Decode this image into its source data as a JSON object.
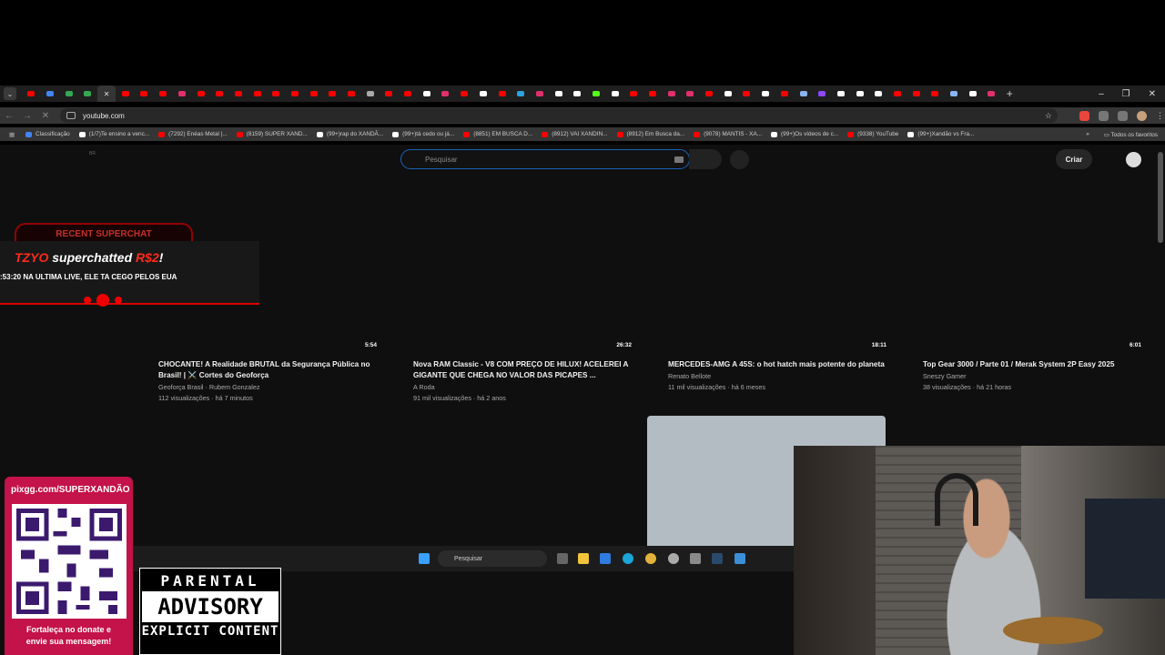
{
  "browser": {
    "url": "youtube.com",
    "tab_colors": [
      "#ff0000",
      "#4285f4",
      "#34a853",
      "#34a853",
      "#ff0000",
      "#ff0000",
      "#ff0000",
      "#ff0000",
      "#e1306c",
      "#ff0000",
      "#ff0000",
      "#ff0000",
      "#ff0000",
      "#ff0000",
      "#ff0000",
      "#ff0000",
      "#ff0000",
      "#ff0000",
      "#aaaaaa",
      "#ff0000",
      "#ff0000",
      "#ffffff",
      "#e1306c",
      "#ff0000",
      "#ffffff",
      "#ff0000",
      "#2aa3e0",
      "#e1306c",
      "#ffffff",
      "#ffffff",
      "#53fc18",
      "#ffffff",
      "#ff0000",
      "#ff0000",
      "#e1306c",
      "#e1306c",
      "#ff0000",
      "#ffffff",
      "#ff0000",
      "#ffffff",
      "#ff0000",
      "#8ab4f8",
      "#9146ff",
      "#ffffff",
      "#ffffff",
      "#ffffff",
      "#ff0000",
      "#ff0000",
      "#ff0000",
      "#8ab4f8",
      "#ffffff",
      "#e1306c"
    ],
    "new_tab": "+",
    "window_controls": [
      "–",
      "❐",
      "✕"
    ],
    "bookmarks": [
      {
        "label": "Classificação",
        "color": "#4285f4"
      },
      {
        "label": "(1/7)Te ensino a venc...",
        "color": "#ffffff"
      },
      {
        "label": "(7292) Enéas Metal |...",
        "color": "#ff0000"
      },
      {
        "label": "(8159) SUPER XAND...",
        "color": "#ff0000"
      },
      {
        "label": "(99+)rap do XANDÃ...",
        "color": "#ffffff"
      },
      {
        "label": "(99+)tá cedo ou já...",
        "color": "#ffffff"
      },
      {
        "label": "(8851) EM BUSCA D...",
        "color": "#ff0000"
      },
      {
        "label": "(8912) VAI XANDIN...",
        "color": "#ff0000"
      },
      {
        "label": "(8912) Em Busca da...",
        "color": "#ff0000"
      },
      {
        "label": "(9078) MANTIS - XA...",
        "color": "#ff0000"
      },
      {
        "label": "(99+)Os vídeos de c...",
        "color": "#ffffff"
      },
      {
        "label": "(9338) YouTube",
        "color": "#ff0000"
      },
      {
        "label": "(99+)Xandão vs Fra...",
        "color": "#ffffff"
      }
    ],
    "bookmarks_more": "»",
    "all_bookmarks": "Todos os favoritos"
  },
  "youtube": {
    "logo_region": "BR",
    "search_placeholder": "Pesquisar",
    "create_label": "Criar",
    "videos": [
      {
        "duration": "5:54",
        "title": "CHOCANTE! A Realidade BRUTAL da Segurança Pública no Brasil! | ⚔️ Cortes do Geoforça",
        "channel": "Geoforça Brasil · Rubem Gonzalez",
        "stats": "112 visualizações · há 7 minutos"
      },
      {
        "duration": "26:32",
        "title": "Nova RAM Classic - V8 COM PREÇO DE HILUX! ACELEREI A GIGANTE QUE CHEGA NO VALOR DAS PICAPES ...",
        "channel": "A Roda",
        "stats": "91 mil visualizações · há 2 anos"
      },
      {
        "duration": "18:11",
        "title": "MERCEDES-AMG A 45S: o hot hatch mais potente do planeta",
        "channel": "Renato Bellote",
        "stats": "11 mil visualizações · há 6 meses"
      },
      {
        "duration": "6:01",
        "title": "Top Gear 3000 / Parte 01 / Merak System 2P Easy 2025",
        "channel": "Sneszy Gamer",
        "stats": "38 visualizações · há 21 horas"
      }
    ]
  },
  "overlays": {
    "superchat_header": "RECENT SUPERCHAT",
    "superchat_user": "TZYO",
    "superchat_verb": " superchatted ",
    "superchat_amount": "R$2",
    "superchat_bang": "!",
    "superchat_message": ":53:20 NA ULTIMA LIVE, ELE TA CEGO PELOS EUA",
    "pix_url": "pixgg.com/SUPERXANDÃO",
    "pix_cta_1": "Fortaleça no donate e",
    "pix_cta_2": "envie sua mensagem!",
    "advisory_1": "PARENTAL",
    "advisory_2": "ADVISORY",
    "advisory_3": "EXPLICIT CONTENT",
    "taskbar_search": "Pesquisar"
  }
}
